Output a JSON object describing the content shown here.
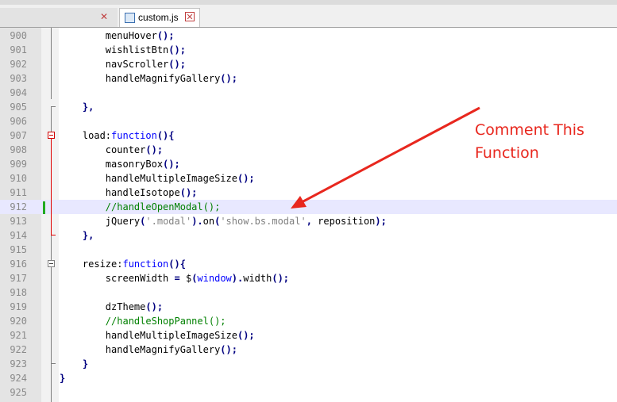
{
  "tabs": [
    {
      "label": "",
      "active": false
    },
    {
      "label": "custom.js",
      "active": true
    }
  ],
  "annotation": "Comment This\nFunction",
  "colors": {
    "annotation": "#e8271e",
    "comment": "#008000",
    "keyword": "#0000ff"
  },
  "lines": [
    {
      "n": "900",
      "tokens": [
        [
          "fn",
          "        menuHover"
        ],
        [
          "p",
          "();"
        ]
      ]
    },
    {
      "n": "901",
      "tokens": [
        [
          "fn",
          "        wishlistBtn"
        ],
        [
          "p",
          "();"
        ]
      ]
    },
    {
      "n": "902",
      "tokens": [
        [
          "fn",
          "        navScroller"
        ],
        [
          "p",
          "();"
        ]
      ]
    },
    {
      "n": "903",
      "tokens": [
        [
          "fn",
          "        handleMagnifyGallery"
        ],
        [
          "p",
          "();"
        ]
      ]
    },
    {
      "n": "904",
      "tokens": []
    },
    {
      "n": "905",
      "tokens": [
        [
          "p",
          "    },"
        ]
      ]
    },
    {
      "n": "906",
      "tokens": []
    },
    {
      "n": "907",
      "tokens": [
        [
          "fn",
          "    load:"
        ],
        [
          "kw",
          "function"
        ],
        [
          "p",
          "(){"
        ]
      ]
    },
    {
      "n": "908",
      "tokens": [
        [
          "fn",
          "        counter"
        ],
        [
          "p",
          "();"
        ]
      ]
    },
    {
      "n": "909",
      "tokens": [
        [
          "fn",
          "        masonryBox"
        ],
        [
          "p",
          "();"
        ]
      ]
    },
    {
      "n": "910",
      "tokens": [
        [
          "fn",
          "        handleMultipleImageSize"
        ],
        [
          "p",
          "();"
        ]
      ]
    },
    {
      "n": "911",
      "tokens": [
        [
          "fn",
          "        handleIsotope"
        ],
        [
          "p",
          "();"
        ]
      ]
    },
    {
      "n": "912",
      "tokens": [
        [
          "cm",
          "        //handleOpenModal();"
        ]
      ],
      "current": true
    },
    {
      "n": "913",
      "tokens": [
        [
          "fn",
          "        jQuery"
        ],
        [
          "p",
          "("
        ],
        [
          "str",
          "'.modal'"
        ],
        [
          "p",
          ")."
        ],
        [
          "fn",
          "on"
        ],
        [
          "p",
          "("
        ],
        [
          "str",
          "'show.bs.modal'"
        ],
        [
          "p",
          ","
        ],
        [
          "fn",
          " reposition"
        ],
        [
          "p",
          ");"
        ]
      ]
    },
    {
      "n": "914",
      "tokens": [
        [
          "p",
          "    },"
        ]
      ]
    },
    {
      "n": "915",
      "tokens": []
    },
    {
      "n": "916",
      "tokens": [
        [
          "fn",
          "    resize:"
        ],
        [
          "kw",
          "function"
        ],
        [
          "p",
          "(){"
        ]
      ]
    },
    {
      "n": "917",
      "tokens": [
        [
          "fn",
          "        screenWidth "
        ],
        [
          "p",
          "="
        ],
        [
          "fn",
          " $"
        ],
        [
          "p",
          "("
        ],
        [
          "kw",
          "window"
        ],
        [
          "p",
          ")."
        ],
        [
          "fn",
          "width"
        ],
        [
          "p",
          "();"
        ]
      ]
    },
    {
      "n": "918",
      "tokens": []
    },
    {
      "n": "919",
      "tokens": [
        [
          "fn",
          "        dzTheme"
        ],
        [
          "p",
          "();"
        ]
      ]
    },
    {
      "n": "920",
      "tokens": [
        [
          "cm",
          "        //handleShopPannel();"
        ]
      ]
    },
    {
      "n": "921",
      "tokens": [
        [
          "fn",
          "        handleMultipleImageSize"
        ],
        [
          "p",
          "();"
        ]
      ]
    },
    {
      "n": "922",
      "tokens": [
        [
          "fn",
          "        handleMagnifyGallery"
        ],
        [
          "p",
          "();"
        ]
      ]
    },
    {
      "n": "923",
      "tokens": [
        [
          "p",
          "    }"
        ]
      ]
    },
    {
      "n": "924",
      "tokens": [
        [
          "p",
          "}"
        ]
      ]
    },
    {
      "n": "925",
      "tokens": []
    }
  ]
}
